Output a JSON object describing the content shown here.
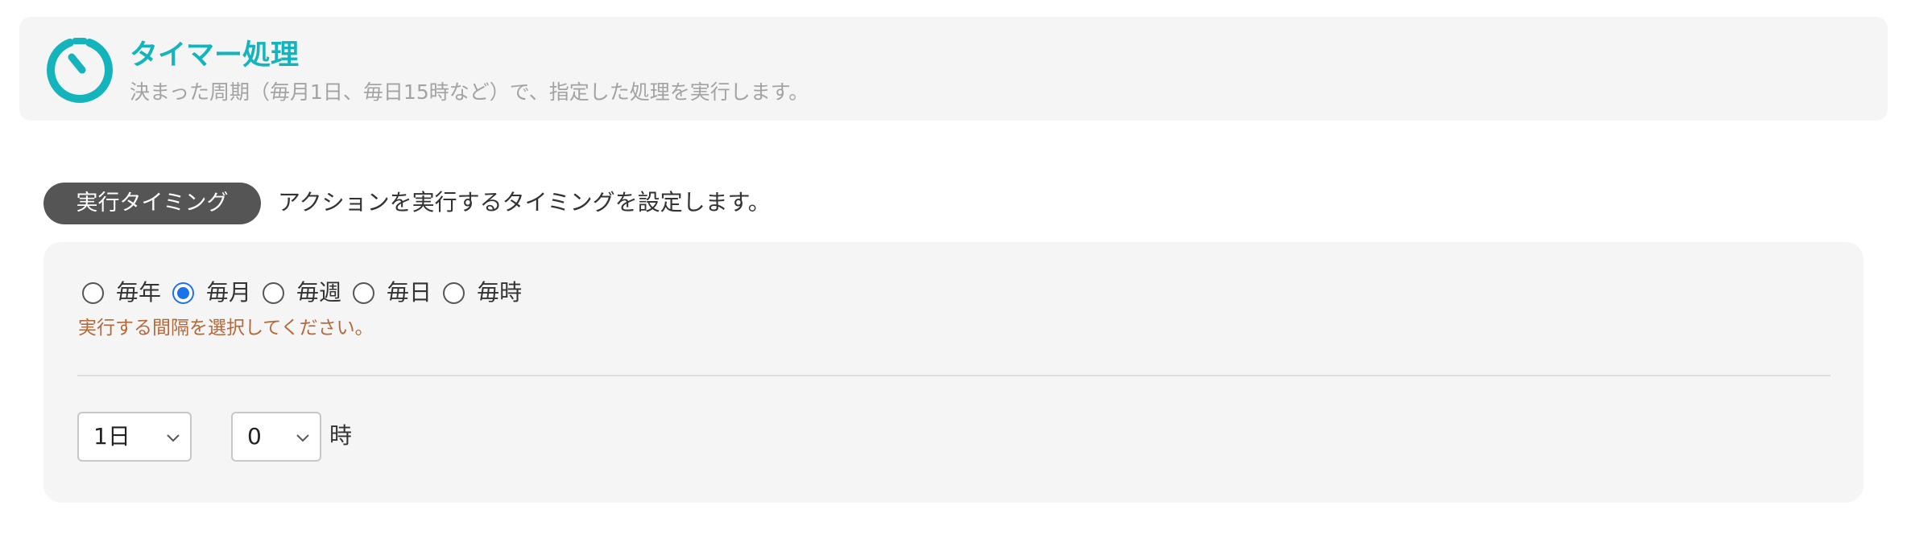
{
  "header": {
    "title": "タイマー処理",
    "description": "決まった周期（毎月1日、毎日15時など）で、指定した処理を実行します。",
    "icon": "timer-icon",
    "accent_color": "#14b4bd"
  },
  "section": {
    "badge_label": "実行タイミング",
    "description": "アクションを実行するタイミングを設定します。"
  },
  "interval": {
    "options": [
      {
        "label": "毎年",
        "checked": false
      },
      {
        "label": "毎月",
        "checked": true
      },
      {
        "label": "毎週",
        "checked": false
      },
      {
        "label": "毎日",
        "checked": false
      },
      {
        "label": "毎時",
        "checked": false
      }
    ],
    "helper_text": "実行する間隔を選択してください。",
    "helper_color": "#b4693a"
  },
  "schedule": {
    "day_value": "1日",
    "hour_value": "0",
    "hour_unit": "時"
  }
}
